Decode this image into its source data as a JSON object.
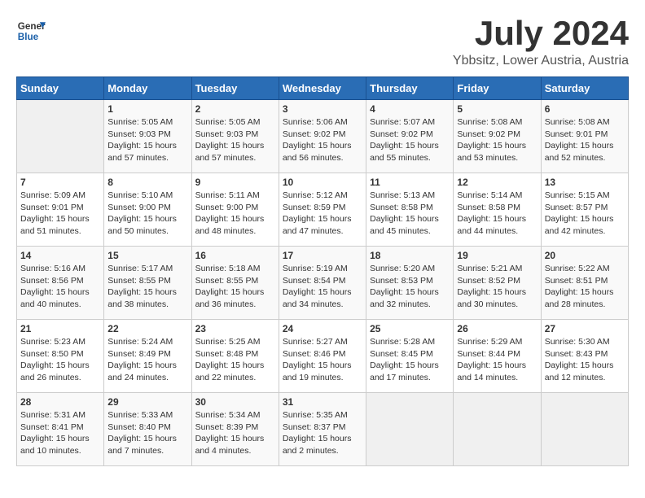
{
  "header": {
    "logo_general": "General",
    "logo_blue": "Blue",
    "month_year": "July 2024",
    "location": "Ybbsitz, Lower Austria, Austria"
  },
  "weekdays": [
    "Sunday",
    "Monday",
    "Tuesday",
    "Wednesday",
    "Thursday",
    "Friday",
    "Saturday"
  ],
  "weeks": [
    [
      {
        "day": "",
        "sunrise": "",
        "sunset": "",
        "daylight": ""
      },
      {
        "day": "1",
        "sunrise": "Sunrise: 5:05 AM",
        "sunset": "Sunset: 9:03 PM",
        "daylight": "Daylight: 15 hours and 57 minutes."
      },
      {
        "day": "2",
        "sunrise": "Sunrise: 5:05 AM",
        "sunset": "Sunset: 9:03 PM",
        "daylight": "Daylight: 15 hours and 57 minutes."
      },
      {
        "day": "3",
        "sunrise": "Sunrise: 5:06 AM",
        "sunset": "Sunset: 9:02 PM",
        "daylight": "Daylight: 15 hours and 56 minutes."
      },
      {
        "day": "4",
        "sunrise": "Sunrise: 5:07 AM",
        "sunset": "Sunset: 9:02 PM",
        "daylight": "Daylight: 15 hours and 55 minutes."
      },
      {
        "day": "5",
        "sunrise": "Sunrise: 5:08 AM",
        "sunset": "Sunset: 9:02 PM",
        "daylight": "Daylight: 15 hours and 53 minutes."
      },
      {
        "day": "6",
        "sunrise": "Sunrise: 5:08 AM",
        "sunset": "Sunset: 9:01 PM",
        "daylight": "Daylight: 15 hours and 52 minutes."
      }
    ],
    [
      {
        "day": "7",
        "sunrise": "Sunrise: 5:09 AM",
        "sunset": "Sunset: 9:01 PM",
        "daylight": "Daylight: 15 hours and 51 minutes."
      },
      {
        "day": "8",
        "sunrise": "Sunrise: 5:10 AM",
        "sunset": "Sunset: 9:00 PM",
        "daylight": "Daylight: 15 hours and 50 minutes."
      },
      {
        "day": "9",
        "sunrise": "Sunrise: 5:11 AM",
        "sunset": "Sunset: 9:00 PM",
        "daylight": "Daylight: 15 hours and 48 minutes."
      },
      {
        "day": "10",
        "sunrise": "Sunrise: 5:12 AM",
        "sunset": "Sunset: 8:59 PM",
        "daylight": "Daylight: 15 hours and 47 minutes."
      },
      {
        "day": "11",
        "sunrise": "Sunrise: 5:13 AM",
        "sunset": "Sunset: 8:58 PM",
        "daylight": "Daylight: 15 hours and 45 minutes."
      },
      {
        "day": "12",
        "sunrise": "Sunrise: 5:14 AM",
        "sunset": "Sunset: 8:58 PM",
        "daylight": "Daylight: 15 hours and 44 minutes."
      },
      {
        "day": "13",
        "sunrise": "Sunrise: 5:15 AM",
        "sunset": "Sunset: 8:57 PM",
        "daylight": "Daylight: 15 hours and 42 minutes."
      }
    ],
    [
      {
        "day": "14",
        "sunrise": "Sunrise: 5:16 AM",
        "sunset": "Sunset: 8:56 PM",
        "daylight": "Daylight: 15 hours and 40 minutes."
      },
      {
        "day": "15",
        "sunrise": "Sunrise: 5:17 AM",
        "sunset": "Sunset: 8:55 PM",
        "daylight": "Daylight: 15 hours and 38 minutes."
      },
      {
        "day": "16",
        "sunrise": "Sunrise: 5:18 AM",
        "sunset": "Sunset: 8:55 PM",
        "daylight": "Daylight: 15 hours and 36 minutes."
      },
      {
        "day": "17",
        "sunrise": "Sunrise: 5:19 AM",
        "sunset": "Sunset: 8:54 PM",
        "daylight": "Daylight: 15 hours and 34 minutes."
      },
      {
        "day": "18",
        "sunrise": "Sunrise: 5:20 AM",
        "sunset": "Sunset: 8:53 PM",
        "daylight": "Daylight: 15 hours and 32 minutes."
      },
      {
        "day": "19",
        "sunrise": "Sunrise: 5:21 AM",
        "sunset": "Sunset: 8:52 PM",
        "daylight": "Daylight: 15 hours and 30 minutes."
      },
      {
        "day": "20",
        "sunrise": "Sunrise: 5:22 AM",
        "sunset": "Sunset: 8:51 PM",
        "daylight": "Daylight: 15 hours and 28 minutes."
      }
    ],
    [
      {
        "day": "21",
        "sunrise": "Sunrise: 5:23 AM",
        "sunset": "Sunset: 8:50 PM",
        "daylight": "Daylight: 15 hours and 26 minutes."
      },
      {
        "day": "22",
        "sunrise": "Sunrise: 5:24 AM",
        "sunset": "Sunset: 8:49 PM",
        "daylight": "Daylight: 15 hours and 24 minutes."
      },
      {
        "day": "23",
        "sunrise": "Sunrise: 5:25 AM",
        "sunset": "Sunset: 8:48 PM",
        "daylight": "Daylight: 15 hours and 22 minutes."
      },
      {
        "day": "24",
        "sunrise": "Sunrise: 5:27 AM",
        "sunset": "Sunset: 8:46 PM",
        "daylight": "Daylight: 15 hours and 19 minutes."
      },
      {
        "day": "25",
        "sunrise": "Sunrise: 5:28 AM",
        "sunset": "Sunset: 8:45 PM",
        "daylight": "Daylight: 15 hours and 17 minutes."
      },
      {
        "day": "26",
        "sunrise": "Sunrise: 5:29 AM",
        "sunset": "Sunset: 8:44 PM",
        "daylight": "Daylight: 15 hours and 14 minutes."
      },
      {
        "day": "27",
        "sunrise": "Sunrise: 5:30 AM",
        "sunset": "Sunset: 8:43 PM",
        "daylight": "Daylight: 15 hours and 12 minutes."
      }
    ],
    [
      {
        "day": "28",
        "sunrise": "Sunrise: 5:31 AM",
        "sunset": "Sunset: 8:41 PM",
        "daylight": "Daylight: 15 hours and 10 minutes."
      },
      {
        "day": "29",
        "sunrise": "Sunrise: 5:33 AM",
        "sunset": "Sunset: 8:40 PM",
        "daylight": "Daylight: 15 hours and 7 minutes."
      },
      {
        "day": "30",
        "sunrise": "Sunrise: 5:34 AM",
        "sunset": "Sunset: 8:39 PM",
        "daylight": "Daylight: 15 hours and 4 minutes."
      },
      {
        "day": "31",
        "sunrise": "Sunrise: 5:35 AM",
        "sunset": "Sunset: 8:37 PM",
        "daylight": "Daylight: 15 hours and 2 minutes."
      },
      {
        "day": "",
        "sunrise": "",
        "sunset": "",
        "daylight": ""
      },
      {
        "day": "",
        "sunrise": "",
        "sunset": "",
        "daylight": ""
      },
      {
        "day": "",
        "sunrise": "",
        "sunset": "",
        "daylight": ""
      }
    ]
  ]
}
